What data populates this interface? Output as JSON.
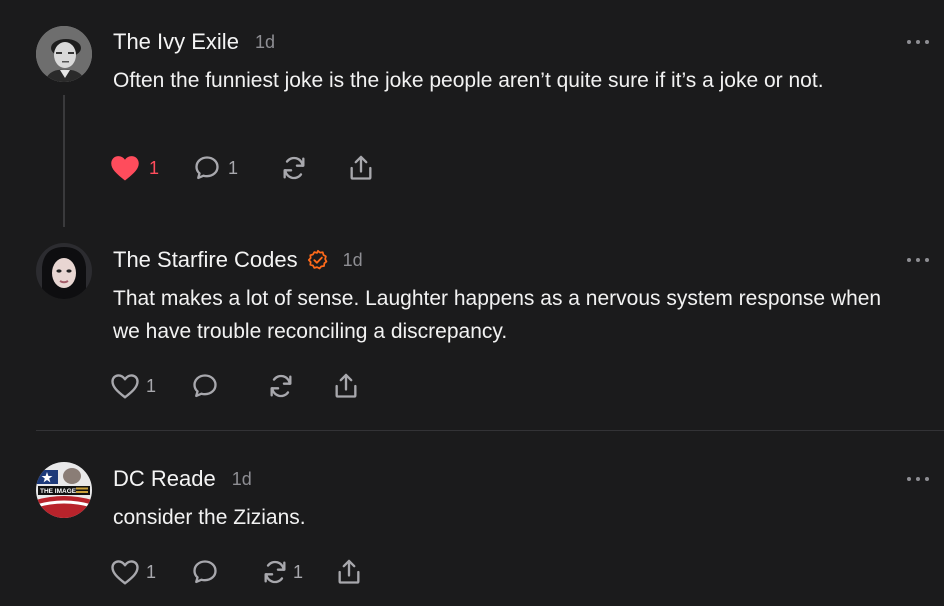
{
  "comments": [
    {
      "author": "The Ivy Exile",
      "time": "1d",
      "text": "Often the funniest joke is the joke people aren’t quite sure if it’s a joke or not.",
      "likes": "1",
      "liked": true,
      "replies": "1",
      "restacks": "",
      "verified": false,
      "avatar_icon": "man-portrait"
    },
    {
      "author": "The Starfire Codes",
      "time": "1d",
      "text": "That makes a lot of sense. Laughter happens as a nervous system response when we have trouble reconciling a discrepancy.",
      "likes": "1",
      "liked": false,
      "replies": "",
      "restacks": "",
      "verified": true,
      "avatar_icon": "woman-portrait"
    },
    {
      "author": "DC Reade",
      "time": "1d",
      "text": "consider the Zizians.",
      "likes": "1",
      "liked": false,
      "replies": "",
      "restacks": "1",
      "verified": false,
      "avatar_icon": "the-image-logo",
      "avatar_text": "THE IMAGE"
    }
  ],
  "colors": {
    "background": "#1b1b1c",
    "liked_heart": "#ff4c5c",
    "verified_badge": "#ff6a1a",
    "muted": "#8e8e93"
  },
  "icons": {
    "like": "heart-icon",
    "reply": "speech-bubble-icon",
    "restack": "restack-icon",
    "share": "share-icon",
    "more": "ellipsis-icon",
    "verified": "verified-badge-icon"
  }
}
